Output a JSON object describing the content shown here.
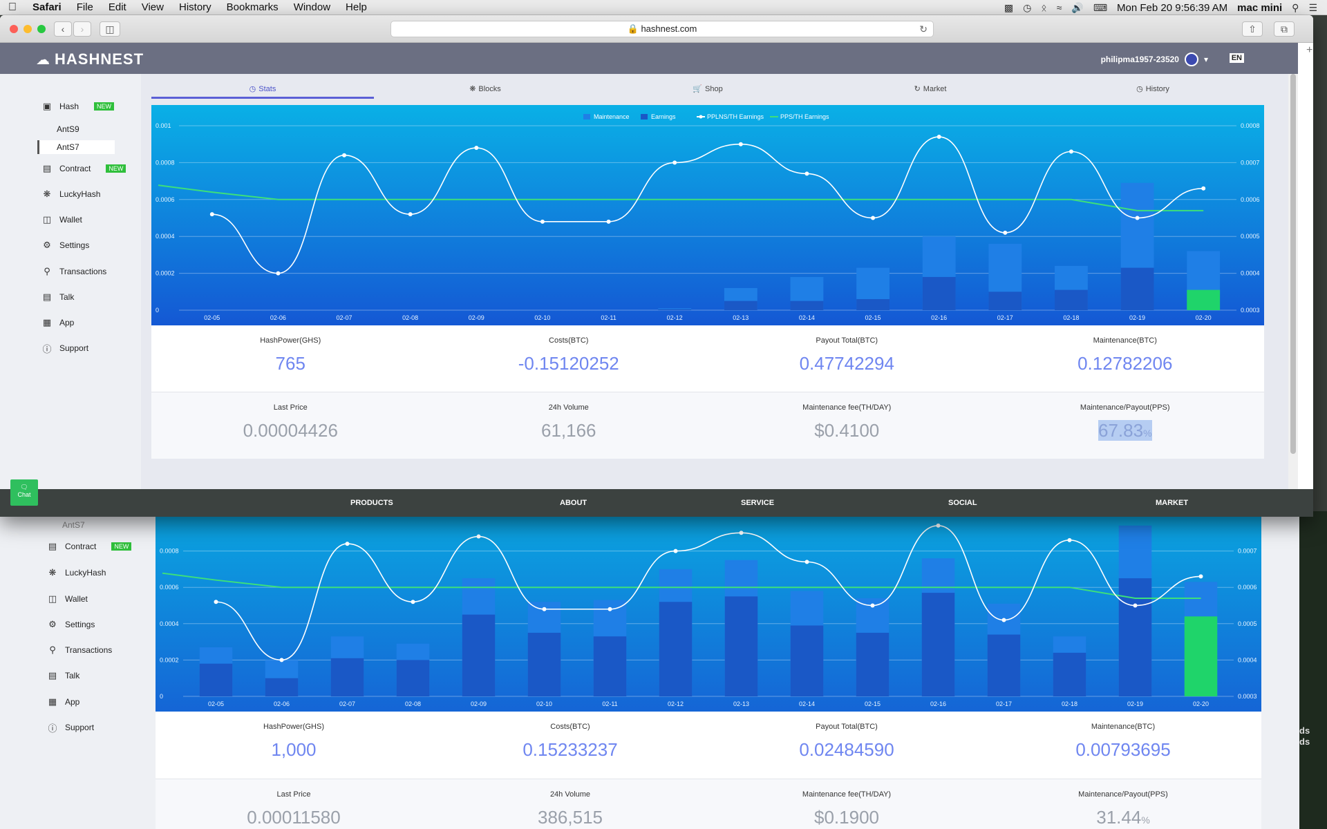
{
  "menubar": {
    "app": "Safari",
    "items": [
      "File",
      "Edit",
      "View",
      "History",
      "Bookmarks",
      "Window",
      "Help"
    ],
    "datetime": "Mon Feb 20  9:56:39 AM",
    "host": "mac mini"
  },
  "browser": {
    "url": "hashnest.com"
  },
  "site": {
    "logo": "HASHNEST",
    "user": "philipma1957-23520",
    "lang": "EN"
  },
  "sidebar": {
    "hash": "Hash",
    "hash_badge": "NEW",
    "sub_ants9": "AntS9",
    "sub_ants7": "AntS7",
    "contract": "Contract",
    "contract_badge": "NEW",
    "luckyhash": "LuckyHash",
    "wallet": "Wallet",
    "settings": "Settings",
    "transactions": "Transactions",
    "talk": "Talk",
    "app": "App",
    "support": "Support"
  },
  "tabs": [
    "Stats",
    "Blocks",
    "Shop",
    "Market",
    "History"
  ],
  "legend": [
    "Maintenance",
    "Earnings",
    "PPLNS/TH Earnings",
    "PPS/TH Earnings"
  ],
  "stats_row1": [
    {
      "label": "HashPower(GHS)",
      "value": "765"
    },
    {
      "label": "Costs(BTC)",
      "value": "-0.15120252"
    },
    {
      "label": "Payout Total(BTC)",
      "value": "0.47742294"
    },
    {
      "label": "Maintenance(BTC)",
      "value": "0.12782206"
    }
  ],
  "stats_row2": [
    {
      "label": "Last Price",
      "value": "0.00004426"
    },
    {
      "label": "24h Volume",
      "value": "61,166"
    },
    {
      "label": "Maintenance fee(TH/DAY)",
      "value": "$0.4100"
    },
    {
      "label": "Maintenance/Payout(PPS)",
      "value": "67.83",
      "unit": "%"
    }
  ],
  "footer": [
    "PRODUCTS",
    "ABOUT",
    "SERVICE",
    "SOCIAL",
    "MARKET"
  ],
  "chat": "Chat",
  "back_stats_row1": [
    {
      "label": "HashPower(GHS)",
      "value": "1,000"
    },
    {
      "label": "Costs(BTC)",
      "value": "0.15233237"
    },
    {
      "label": "Payout Total(BTC)",
      "value": "0.02484590"
    },
    {
      "label": "Maintenance(BTC)",
      "value": "0.00793695"
    }
  ],
  "back_stats_row2": [
    {
      "label": "Last Price",
      "value": "0.00011580"
    },
    {
      "label": "24h Volume",
      "value": "386,515"
    },
    {
      "label": "Maintenance fee(TH/DAY)",
      "value": "$0.1900"
    },
    {
      "label": "Maintenance/Payout(PPS)",
      "value": "31.44",
      "unit": "%"
    }
  ],
  "back_scene_text": [
    "ds",
    "ds"
  ],
  "colors": {
    "maintenance": "#1f7fe6",
    "earnings": "#1a58c6",
    "today": "#1fd46a",
    "pplns": "#ffffff",
    "pps": "#3de07a"
  },
  "chart_data": [
    {
      "type": "bar",
      "categories": [
        "02-05",
        "02-06",
        "02-07",
        "02-08",
        "02-09",
        "02-10",
        "02-11",
        "02-12",
        "02-13",
        "02-14",
        "02-15",
        "02-16",
        "02-17",
        "02-18",
        "02-19",
        "02-20"
      ],
      "yleft_ticks": [
        "0",
        "0.0002",
        "0.0004",
        "0.0006",
        "0.0008",
        "0.001"
      ],
      "yright_ticks": [
        "0.0003",
        "0.0004",
        "0.0005",
        "0.0006",
        "0.0007",
        "0.0008"
      ],
      "ylim_left": [
        0,
        0.001
      ],
      "ylim_right": [
        0.0003,
        0.0008
      ],
      "series": [
        {
          "name": "Maintenance",
          "values": [
            0,
            0,
            0,
            0,
            0,
            0,
            0,
            1e-05,
            0.00012,
            0.00018,
            0.00023,
            0.0004,
            0.00036,
            0.00024,
            0.00069,
            0.00032
          ]
        },
        {
          "name": "Earnings",
          "values": [
            0,
            0,
            0,
            0,
            0,
            0,
            0,
            5e-06,
            5e-05,
            5e-05,
            6e-05,
            0.00018,
            0.0001,
            0.00011,
            0.00023,
            0.00011
          ]
        },
        {
          "name": "PPLNS/TH Earnings",
          "values": [
            0.00056,
            0.0004,
            0.00072,
            0.00056,
            0.00074,
            0.00054,
            0.00054,
            0.0007,
            0.00075,
            0.00067,
            0.00055,
            0.00077,
            0.00051,
            0.00073,
            0.00055,
            0.00063
          ]
        },
        {
          "name": "PPS/TH Earnings",
          "values": [
            0.00062,
            0.0006,
            0.0006,
            0.0006,
            0.0006,
            0.0006,
            0.0006,
            0.0006,
            0.0006,
            0.0006,
            0.0006,
            0.0006,
            0.0006,
            0.0006,
            0.00057,
            0.00057
          ]
        }
      ]
    },
    {
      "type": "bar",
      "categories": [
        "02-05",
        "02-06",
        "02-07",
        "02-08",
        "02-09",
        "02-10",
        "02-11",
        "02-12",
        "02-13",
        "02-14",
        "02-15",
        "02-16",
        "02-17",
        "02-18",
        "02-19",
        "02-20"
      ],
      "yleft_ticks": [
        "0",
        "0.0002",
        "0.0004",
        "0.0006",
        "0.0008"
      ],
      "yright_ticks": [
        "0.0003",
        "0.0004",
        "0.0005",
        "0.0006",
        "0.0007"
      ],
      "ylim_left": [
        0,
        0.001
      ],
      "ylim_right": [
        0.0003,
        0.0008
      ],
      "series": [
        {
          "name": "Maintenance",
          "values": [
            0.00027,
            0.0002,
            0.00033,
            0.00029,
            0.00065,
            0.00052,
            0.00053,
            0.0007,
            0.00075,
            0.00058,
            0.00054,
            0.00076,
            0.00051,
            0.00033,
            0.00094,
            0.00063
          ]
        },
        {
          "name": "Earnings",
          "values": [
            0.00018,
            0.0001,
            0.00021,
            0.0002,
            0.00045,
            0.00035,
            0.00033,
            0.00052,
            0.00055,
            0.00039,
            0.00035,
            0.00057,
            0.00034,
            0.00024,
            0.00065,
            0.00044
          ]
        },
        {
          "name": "PPLNS/TH Earnings",
          "values": [
            0.00056,
            0.0004,
            0.00072,
            0.00056,
            0.00074,
            0.00054,
            0.00054,
            0.0007,
            0.00075,
            0.00067,
            0.00055,
            0.00077,
            0.00051,
            0.00073,
            0.00055,
            0.00063
          ]
        },
        {
          "name": "PPS/TH Earnings",
          "values": [
            0.00062,
            0.0006,
            0.0006,
            0.0006,
            0.0006,
            0.0006,
            0.0006,
            0.0006,
            0.0006,
            0.0006,
            0.0006,
            0.0006,
            0.0006,
            0.0006,
            0.00057,
            0.00057
          ]
        }
      ]
    }
  ]
}
